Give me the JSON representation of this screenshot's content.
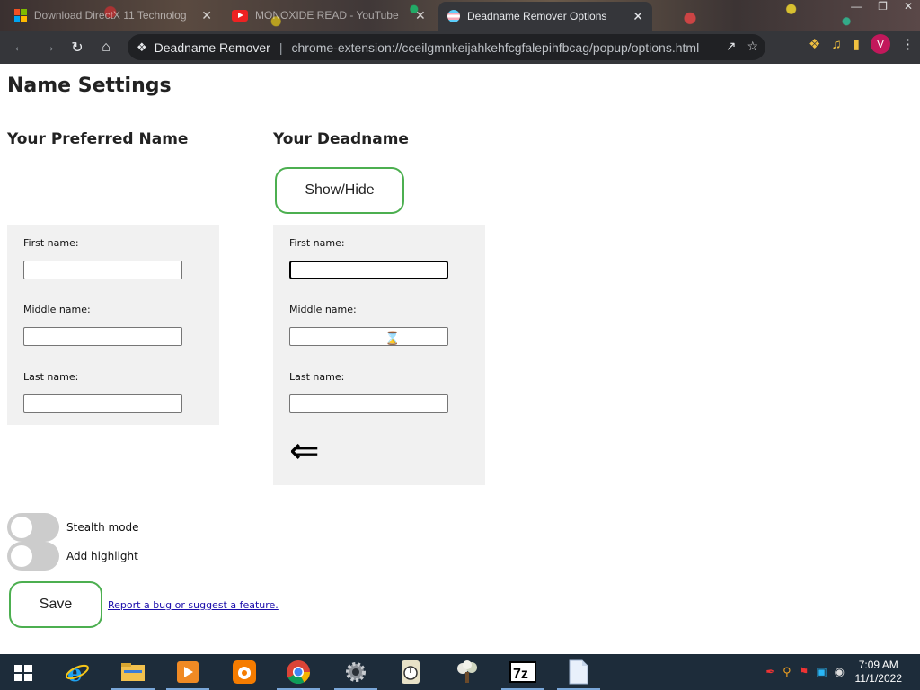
{
  "browser": {
    "tabs": [
      {
        "title": "Download DirectX 11 Technolog",
        "icon": "windows-logo-icon",
        "active": false
      },
      {
        "title": "MONOXIDE READ - YouTube",
        "icon": "youtube-icon",
        "active": false
      },
      {
        "title": "Deadname Remover Options",
        "icon": "trans-flag-icon",
        "active": true
      }
    ],
    "tab_close_glyph": "✕",
    "address": {
      "extension_name": "Deadname Remover",
      "separator": "|",
      "url": "chrome-extension://cceilgmnkeijahkehfcgfalepihfbcag/popup/options.html"
    },
    "profile_initial": "V"
  },
  "page": {
    "title": "Name Settings",
    "preferred": {
      "heading": "Your Preferred Name",
      "first_label": "First name:",
      "middle_label": "Middle name:",
      "last_label": "Last name:",
      "first_value": "",
      "middle_value": "",
      "last_value": ""
    },
    "deadname": {
      "heading": "Your Deadname",
      "toggle_button": "Show/Hide",
      "first_label": "First name:",
      "middle_label": "Middle name:",
      "last_label": "Last name:",
      "first_value": "",
      "middle_value": "",
      "last_value": "",
      "back_glyph": "⇐"
    },
    "options": {
      "stealth_label": "Stealth mode",
      "stealth_on": false,
      "highlight_label": "Add highlight",
      "highlight_on": false
    },
    "save_button": "Save",
    "report_link": "Report a bug or suggest a feature."
  },
  "taskbar": {
    "apps": [
      "internet-explorer-icon",
      "file-explorer-icon",
      "media-player-icon",
      "uc-browser-icon",
      "chrome-icon",
      "settings-gear-icon",
      "timer-app-icon",
      "tree-app-icon",
      "7zip-icon",
      "notepad-icon"
    ],
    "time": "7:09 AM",
    "date": "11/1/2022"
  },
  "colors": {
    "accent_green": "#4caf50",
    "panel_bg": "#f1f1f1",
    "toggle_off": "#cccccc",
    "link": "#1a0dab",
    "chrome_dark": "#35363a",
    "taskbar": "#1d2c3a"
  }
}
